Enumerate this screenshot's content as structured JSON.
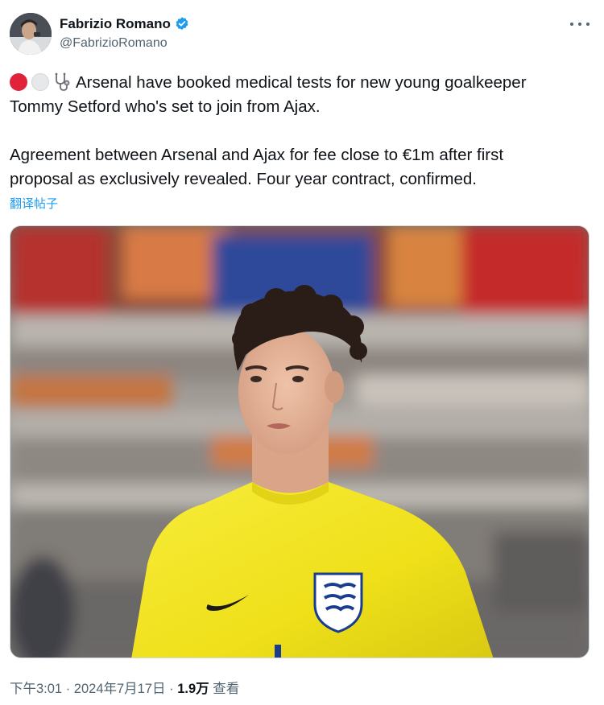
{
  "author": {
    "display_name": "Fabrizio Romano",
    "handle": "@FabrizioRomano",
    "verified": true
  },
  "icons": {
    "verified": "verified-badge-icon",
    "more": "more-horizontal-icon",
    "emoji_1": "red-circle-emoji",
    "emoji_2": "white-circle-emoji",
    "emoji_3": "stethoscope-emoji"
  },
  "tweet": {
    "line_1": "Arsenal have booked medical tests for new young goalkeeper",
    "line_2": "Tommy Setford who's set to join from Ajax.",
    "line_3": "Agreement between Arsenal and Ajax for fee close to €1m after first",
    "line_4": "proposal as exclusively revealed. Four year contract, confirmed.",
    "translate_label": "翻译帖子"
  },
  "meta": {
    "time": "下午3:01",
    "separator_1": " · ",
    "date": "2024年7月17日",
    "separator_2": " · ",
    "views_count": "1.9万",
    "views_label": " 查看"
  },
  "colors": {
    "accent": "#1d9bf0",
    "secondary_text": "#536471",
    "primary_text": "#0f1419",
    "jersey": "#f2e418"
  }
}
